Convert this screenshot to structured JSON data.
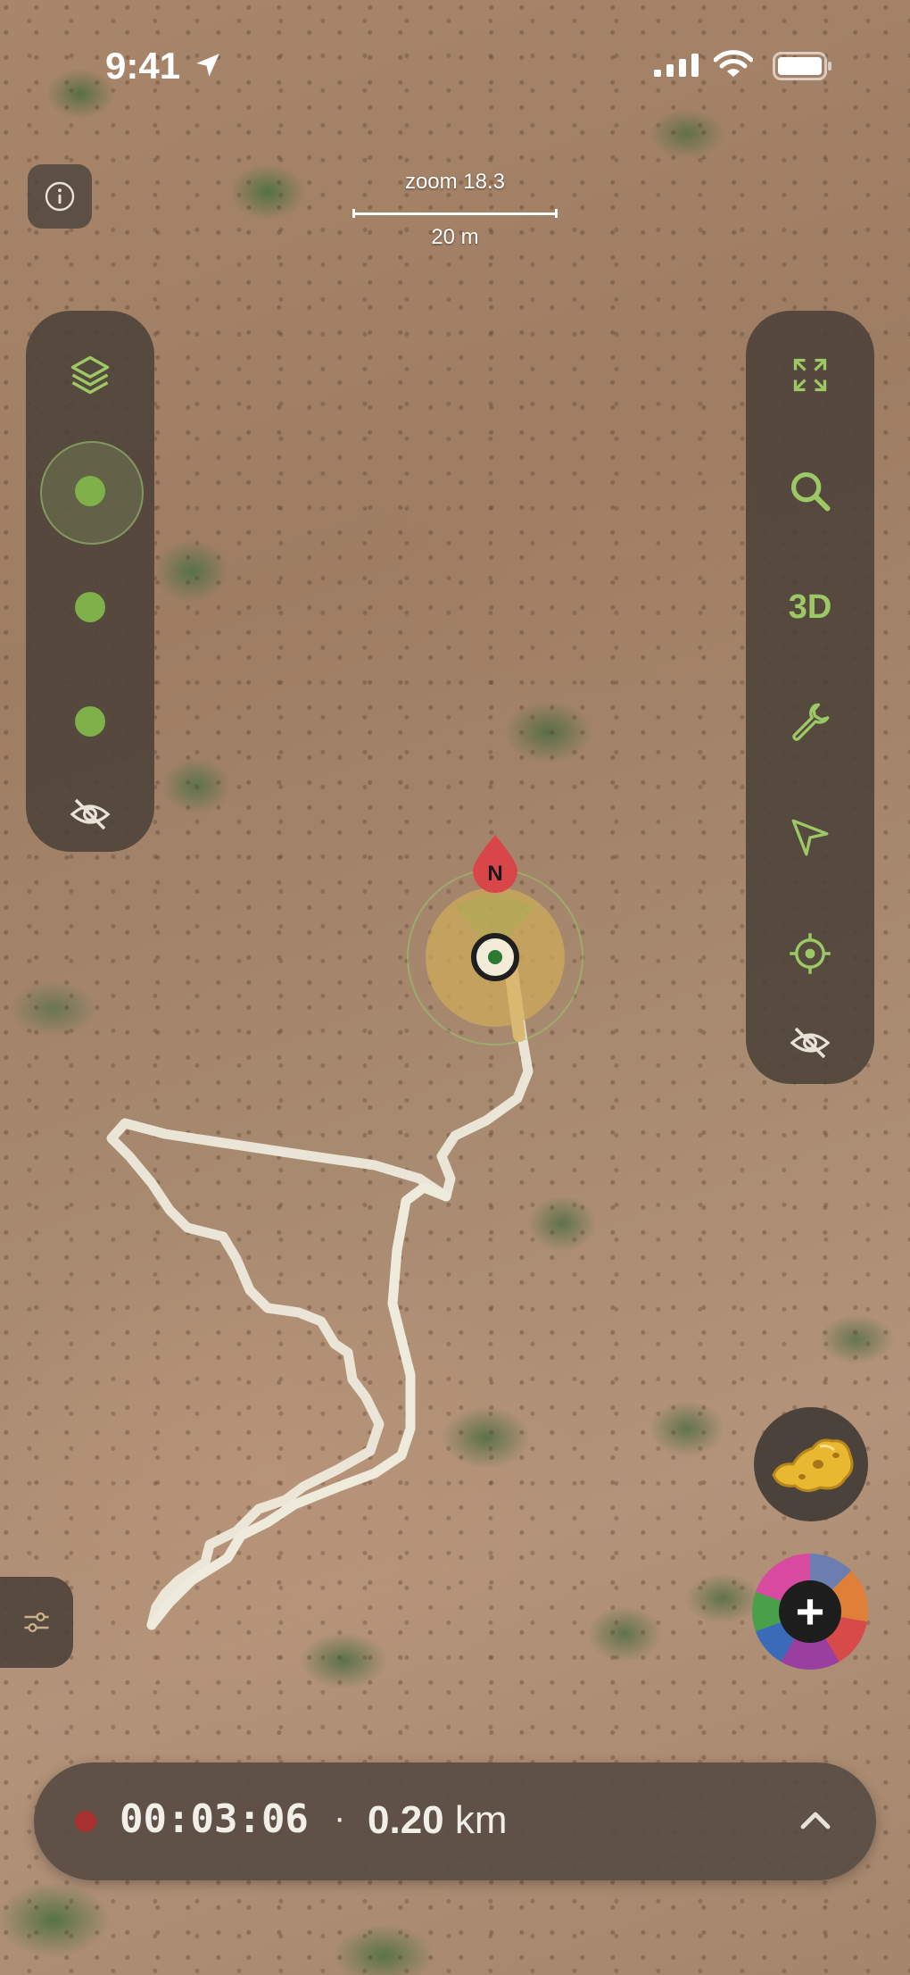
{
  "status_bar": {
    "time": "9:41",
    "location_icon": "location-arrow-icon",
    "signal_icon": "cellular-signal-icon",
    "wifi_icon": "wifi-icon",
    "battery_icon": "battery-icon"
  },
  "map": {
    "zoom_label": "zoom 18.3",
    "scale_label": "20 m",
    "compass_label": "N"
  },
  "left_toolbar": {
    "items": [
      {
        "icon": "layers-icon"
      },
      {
        "icon": "green-dot-icon",
        "selected": true
      },
      {
        "icon": "green-dot-icon"
      },
      {
        "icon": "green-dot-icon"
      },
      {
        "icon": "eye-off-icon"
      }
    ]
  },
  "right_toolbar": {
    "items": [
      {
        "icon": "expand-icon"
      },
      {
        "icon": "search-icon"
      },
      {
        "label": "3D"
      },
      {
        "icon": "wrench-icon"
      },
      {
        "icon": "navigation-arrow-icon"
      },
      {
        "icon": "crosshair-icon"
      },
      {
        "icon": "eye-off-icon"
      }
    ]
  },
  "buttons": {
    "info_icon": "info-icon",
    "filters_icon": "sliders-icon",
    "nugget_icon": "gold-nugget-icon",
    "add_label": "+"
  },
  "recording": {
    "elapsed": "00:03:06",
    "separator": "·",
    "distance": "0.20",
    "unit": "km",
    "expand_icon": "chevron-up-icon",
    "colors": {
      "record": "#a83232",
      "accent": "#9cc866"
    }
  }
}
